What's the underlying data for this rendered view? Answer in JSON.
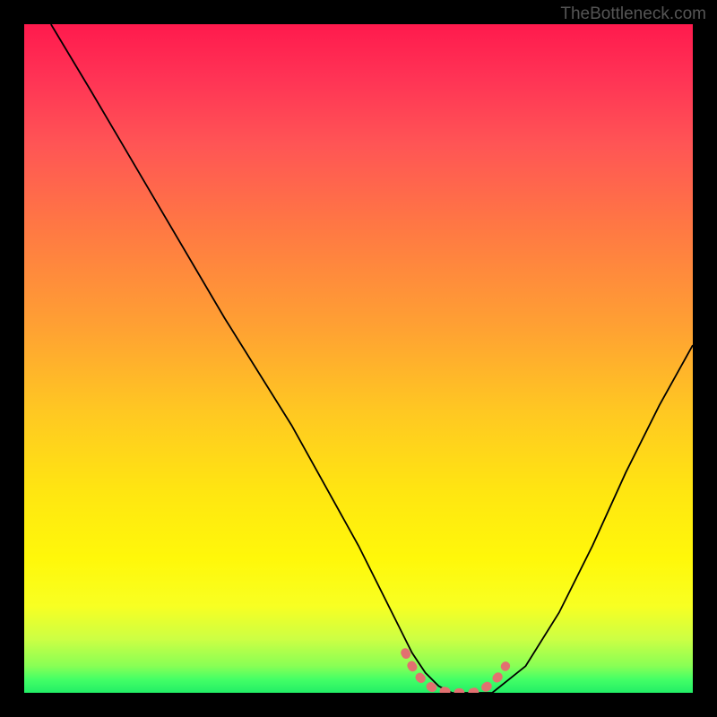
{
  "watermark": "TheBottleneck.com",
  "chart_data": {
    "type": "line",
    "title": "",
    "xlabel": "",
    "ylabel": "",
    "xlim": [
      0,
      100
    ],
    "ylim": [
      0,
      100
    ],
    "series": [
      {
        "name": "bottleneck-curve",
        "color": "#000000",
        "x": [
          4,
          10,
          20,
          30,
          40,
          50,
          56,
          58,
          60,
          62,
          64,
          66,
          68,
          70,
          75,
          80,
          85,
          90,
          95,
          100
        ],
        "y": [
          100,
          90,
          73,
          56,
          40,
          22,
          10,
          6,
          3,
          1,
          0,
          0,
          0,
          0,
          4,
          12,
          22,
          33,
          43,
          52
        ]
      },
      {
        "name": "optimal-range-marker",
        "color": "#e27070",
        "x": [
          57,
          58,
          59,
          60,
          61,
          62,
          63,
          64,
          65,
          66,
          67,
          68,
          69,
          70,
          71,
          72
        ],
        "y": [
          6,
          4,
          2.5,
          1.5,
          0.8,
          0.4,
          0.2,
          0,
          0,
          0,
          0,
          0.3,
          0.8,
          1.5,
          2.5,
          4
        ]
      }
    ],
    "background_gradient": {
      "type": "vertical",
      "stops": [
        {
          "pos": 0,
          "color": "#ff1a4d"
        },
        {
          "pos": 0.3,
          "color": "#ff7744"
        },
        {
          "pos": 0.6,
          "color": "#ffd622"
        },
        {
          "pos": 0.85,
          "color": "#f8ff22"
        },
        {
          "pos": 1.0,
          "color": "#22ee66"
        }
      ]
    }
  }
}
